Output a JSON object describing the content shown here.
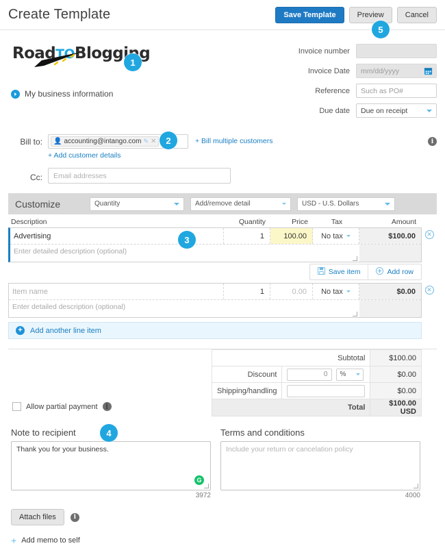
{
  "header": {
    "title": "Create Template",
    "save_label": "Save Template",
    "preview_label": "Preview",
    "cancel_label": "Cancel"
  },
  "callouts": [
    {
      "id": "b1",
      "label": "1"
    },
    {
      "id": "b2",
      "label": "2"
    },
    {
      "id": "b3",
      "label": "3"
    },
    {
      "id": "b4",
      "label": "4"
    },
    {
      "id": "b5",
      "label": "5"
    }
  ],
  "logo": {
    "part1": "Road",
    "part2": "TO",
    "part3": "Blogging"
  },
  "business": {
    "link_label": "My business information"
  },
  "invoice_fields": [
    {
      "label": "Invoice number",
      "value": "",
      "placeholder": "",
      "type": "text",
      "disabled": true
    },
    {
      "label": "Invoice Date",
      "value": "",
      "placeholder": "mm/dd/yyyy",
      "type": "date",
      "disabled": true
    },
    {
      "label": "Reference",
      "value": "",
      "placeholder": "Such as PO#",
      "type": "text",
      "disabled": false
    },
    {
      "label": "Due date",
      "value": "Due on receipt",
      "placeholder": "",
      "type": "select",
      "disabled": false
    }
  ],
  "billto": {
    "label": "Bill to:",
    "chip_email": "accounting@intango.com",
    "bill_multiple_label": "+ Bill multiple customers",
    "add_customer_label": "+ Add customer details",
    "cc_label": "Cc:",
    "cc_placeholder": "Email addresses"
  },
  "customize": {
    "title": "Customize",
    "select_quantity": "Quantity",
    "select_detail": "Add/remove detail",
    "select_currency": "USD - U.S. Dollars"
  },
  "line_table": {
    "columns": {
      "description": "Description",
      "quantity": "Quantity",
      "price": "Price",
      "tax": "Tax",
      "amount": "Amount"
    },
    "rows": [
      {
        "description": "Advertising",
        "description_placeholder": "",
        "quantity": "1",
        "price": "100.00",
        "tax": "No tax",
        "amount": "$100.00",
        "note_placeholder": "Enter detailed description (optional)",
        "active": true,
        "price_highlight": true
      },
      {
        "description": "",
        "description_placeholder": "Item name",
        "quantity": "1",
        "price": "0.00",
        "tax": "No tax",
        "amount": "$0.00",
        "note_placeholder": "Enter detailed description (optional)",
        "active": false,
        "price_highlight": false
      }
    ],
    "save_item_label": "Save item",
    "add_row_label": "Add row",
    "add_line_item_label": "Add another line item"
  },
  "totals": {
    "subtotal_label": "Subtotal",
    "subtotal_value": "$100.00",
    "discount_label": "Discount",
    "discount_input": "0",
    "discount_unit": "%",
    "discount_value": "$0.00",
    "shipping_label": "Shipping/handling",
    "shipping_input": "",
    "shipping_value": "$0.00",
    "total_label": "Total",
    "total_value": "$100.00 USD",
    "partial_payment_label": "Allow partial payment"
  },
  "notes": {
    "note_title": "Note to recipient",
    "note_value": "Thank you for your business.",
    "note_counter": "3972",
    "terms_title": "Terms and conditions",
    "terms_placeholder": "Include your return or cancelation policy",
    "terms_counter": "4000",
    "attach_label": "Attach files",
    "memo_label": "Add memo to self"
  },
  "colors": {
    "accent": "#21a7e0",
    "primary_button": "#1f7ac4",
    "link": "#1a7fc1",
    "highlight": "#fbf7c8"
  }
}
